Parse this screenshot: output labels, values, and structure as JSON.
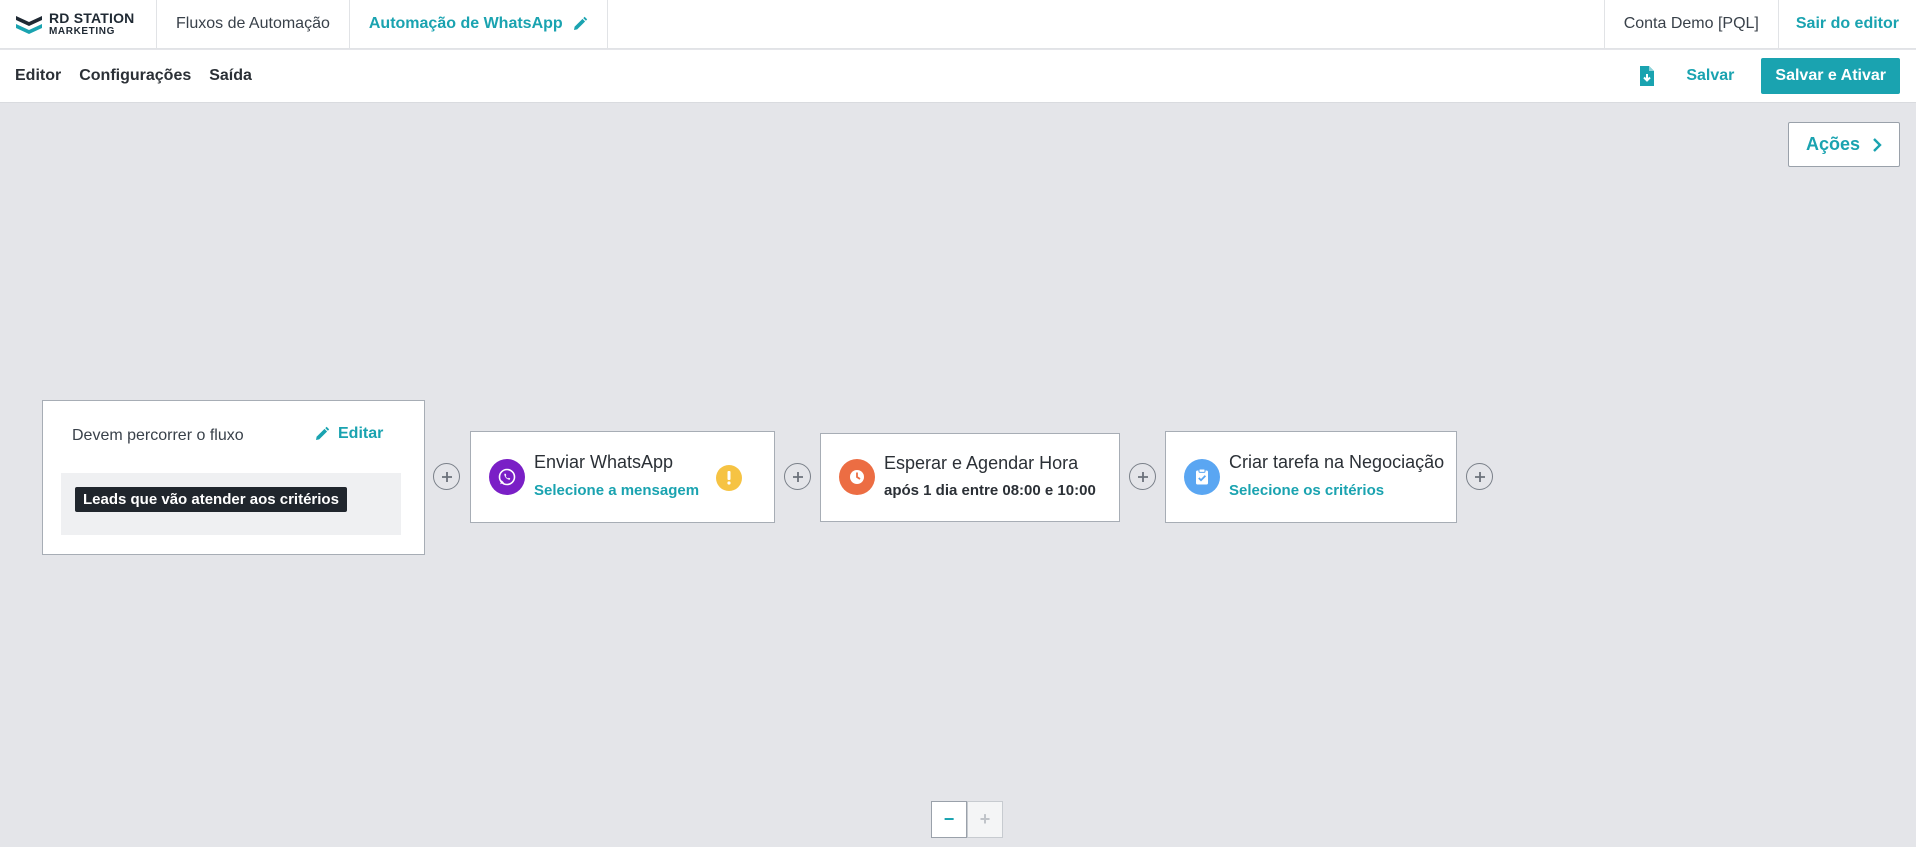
{
  "brand": {
    "line1": "RD STATION",
    "line2": "MARKETING"
  },
  "topnav": {
    "flows": "Fluxos de Automação",
    "current_flow": "Automação de WhatsApp",
    "account": "Conta Demo [PQL]",
    "exit": "Sair do editor"
  },
  "subnav": {
    "editor": "Editor",
    "settings": "Configurações",
    "exit": "Saída",
    "save": "Salvar",
    "save_activate": "Salvar e Ativar"
  },
  "actions_label": "Ações",
  "entry": {
    "title": "Devem percorrer o fluxo",
    "edit": "Editar",
    "criteria": "Leads que vão atender aos critérios"
  },
  "steps": [
    {
      "title": "Enviar WhatsApp",
      "subtitle": "Selecione a mensagem",
      "icon": "whatsapp-icon",
      "color": "#7a1fc6",
      "warning": true
    },
    {
      "title": "Esperar e Agendar Hora",
      "subtitle": "após 1 dia entre 08:00 e 10:00",
      "icon": "clock-icon",
      "color": "#ec6d43"
    },
    {
      "title": "Criar tarefa na Negociação",
      "subtitle": "Selecione os critérios",
      "icon": "clipboard-check-icon",
      "color": "#5aa6f2"
    }
  ],
  "zoom": {
    "out": "−",
    "in": "+"
  },
  "colors": {
    "accent": "#1aa3b0",
    "warning": "#f6c343",
    "canvas": "#e4e5e9"
  }
}
